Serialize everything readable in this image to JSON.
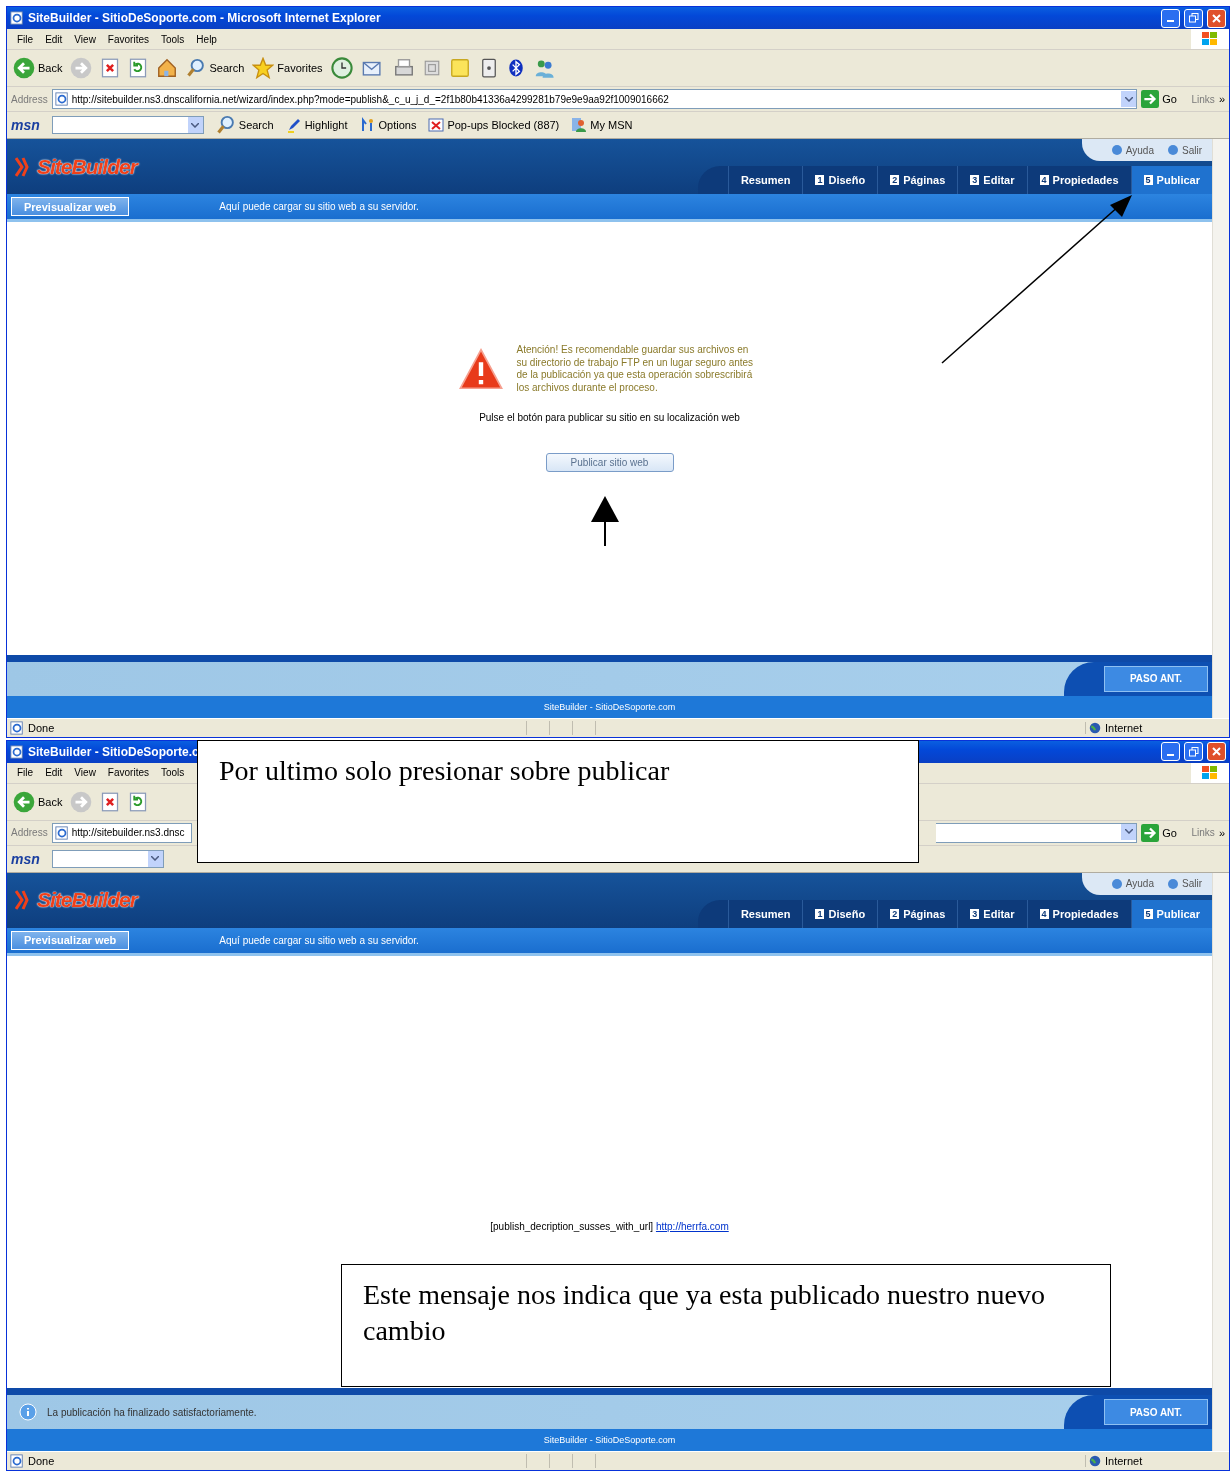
{
  "windows": [
    {
      "title": "SiteBuilder - SitioDeSoporte.com - Microsoft Internet Explorer",
      "menu": [
        "File",
        "Edit",
        "View",
        "Favorites",
        "Tools",
        "Help"
      ],
      "toolbar": [
        {
          "kind": "back",
          "label": "Back"
        },
        {
          "kind": "forward"
        },
        {
          "kind": "stop"
        },
        {
          "kind": "refresh"
        },
        {
          "kind": "home"
        },
        {
          "kind": "search",
          "label": "Search"
        },
        {
          "kind": "favorites",
          "label": "Favorites"
        },
        {
          "kind": "history"
        },
        {
          "kind": "mail"
        },
        {
          "kind": "print"
        },
        {
          "kind": "edit"
        },
        {
          "kind": "note"
        },
        {
          "kind": "device"
        },
        {
          "kind": "bluetooth"
        },
        {
          "kind": "messenger"
        }
      ],
      "address_label": "Address",
      "url": "http://sitebuilder.ns3.dnscalifornia.net/wizard/index.php?mode=publish&_c_u_j_d_=2f1b80b41336a4299281b79e9e9aa92f1009016662",
      "go": "Go",
      "links": "Links",
      "links_chevron": "»",
      "msn_logo": "msn",
      "msn_items": [
        {
          "kind": "search",
          "label": "Search"
        },
        {
          "kind": "highlight",
          "label": "Highlight"
        },
        {
          "kind": "options",
          "label": "Options"
        },
        {
          "kind": "popups",
          "label": "Pop-ups Blocked (887)"
        },
        {
          "kind": "mymsn",
          "label": "My MSN"
        }
      ],
      "app": {
        "logo": "SiteBuilder",
        "help": "Ayuda",
        "exit": "Salir",
        "tabs": [
          {
            "label": "Resumen",
            "selected": false
          },
          {
            "number": "1",
            "label": "Diseño",
            "selected": false
          },
          {
            "number": "2",
            "label": "Páginas",
            "selected": false
          },
          {
            "number": "3",
            "label": "Editar",
            "selected": false
          },
          {
            "number": "4",
            "label": "Propiedades",
            "selected": false
          },
          {
            "number": "5",
            "label": "Publicar",
            "selected": true
          }
        ],
        "preview_button": "Previsualizar web",
        "hint": "Aquí puede cargar su sitio web a su servidor.",
        "content": {
          "kind": "publish_prompt",
          "warning": "Atención! Es recomendable guardar sus archivos en su directorio de trabajo FTP en un lugar seguro antes de la publicación ya que esta operación sobrescribirá los archivos durante el proceso.",
          "instruction": "Pulse el botón para publicar su sitio en su localización web",
          "button": "Publicar sitio web"
        },
        "footer": {
          "next_button": "PASO ANT.",
          "credit": "SiteBuilder - SitioDeSoporte.com"
        }
      },
      "status": {
        "text": "Done",
        "zone": "Internet"
      }
    },
    {
      "title": "SiteBuilder - SitioDeSoporte.c",
      "menu": [
        "File",
        "Edit",
        "View",
        "Favorites",
        "Tools"
      ],
      "toolbar": [
        {
          "kind": "back",
          "label": "Back"
        },
        {
          "kind": "forward"
        },
        {
          "kind": "stop"
        },
        {
          "kind": "refresh"
        }
      ],
      "address_label": "Address",
      "url": "http://sitebuilder.ns3.dnsc",
      "go": "Go",
      "links": "Links",
      "links_chevron": "»",
      "msn_logo": "msn",
      "app": {
        "logo": "SiteBuilder",
        "help": "Ayuda",
        "exit": "Salir",
        "tabs": [
          {
            "label": "Resumen",
            "selected": false
          },
          {
            "number": "1",
            "label": "Diseño",
            "selected": false
          },
          {
            "number": "2",
            "label": "Páginas",
            "selected": false
          },
          {
            "number": "3",
            "label": "Editar",
            "selected": false
          },
          {
            "number": "4",
            "label": "Propiedades",
            "selected": false
          },
          {
            "number": "5",
            "label": "Publicar",
            "selected": true
          }
        ],
        "preview_button": "Previsualizar web",
        "hint": "Aquí puede cargar su sitio web a su servidor.",
        "content": {
          "kind": "result",
          "message": "[publish_decription_susses_with_url]",
          "link": "http://herrfa.com"
        },
        "footer": {
          "message": "La publicación ha finalizado satisfactoriamente.",
          "next_button": "PASO ANT.",
          "credit": "SiteBuilder - SitioDeSoporte.com"
        }
      },
      "status": {
        "text": "Done",
        "zone": "Internet"
      }
    }
  ],
  "notes": [
    {
      "text": "Por ultimo solo presionar sobre publicar"
    },
    {
      "text": "Este mensaje nos indica que ya esta publicado nuestro nuevo cambio"
    }
  ]
}
